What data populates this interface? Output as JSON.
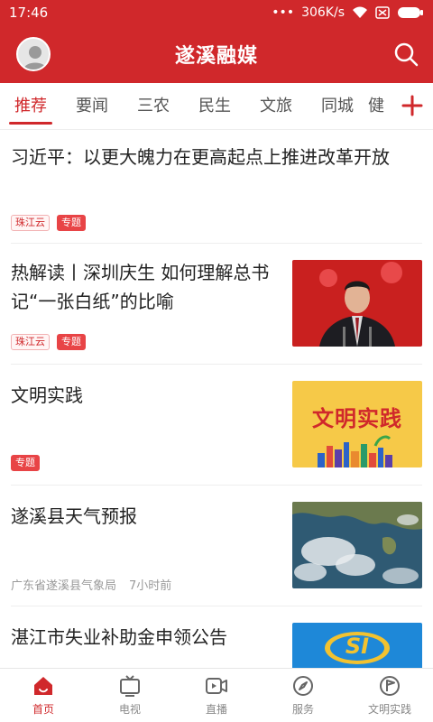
{
  "status_bar": {
    "time": "17:46",
    "network_speed": "306K/s"
  },
  "header": {
    "title": "遂溪融媒"
  },
  "tabs": [
    {
      "label": "推荐",
      "active": true
    },
    {
      "label": "要闻"
    },
    {
      "label": "三农"
    },
    {
      "label": "民生"
    },
    {
      "label": "文旅"
    },
    {
      "label": "同城"
    },
    {
      "label": "健"
    }
  ],
  "feed": [
    {
      "headline": "习近平：以更大魄力在更高起点上推进改革开放",
      "tags": [
        "珠江云",
        "专题"
      ]
    },
    {
      "headline": "热解读丨深圳庆生 如何理解总书记“一张白纸”的比喻",
      "tags": [
        "珠江云",
        "专题"
      ],
      "thumb": "portrait"
    },
    {
      "headline": "文明实践",
      "tags": [
        "专题"
      ],
      "thumb": "banner",
      "thumb_text": "文明实践"
    },
    {
      "headline": "遂溪县天气预报",
      "meta_source": "广东省遂溪县气象局",
      "meta_time": "7小时前",
      "thumb": "satellite"
    },
    {
      "headline": "湛江市失业补助金申领公告",
      "thumb": "logo",
      "thumb_text": "SI"
    }
  ],
  "bottom_nav": [
    {
      "label": "首页",
      "icon": "home-icon",
      "active": true
    },
    {
      "label": "电视",
      "icon": "tv-icon"
    },
    {
      "label": "直播",
      "icon": "video-icon"
    },
    {
      "label": "服务",
      "icon": "compass-icon"
    },
    {
      "label": "文明实践",
      "icon": "flag-icon"
    }
  ],
  "colors": {
    "brand": "#d0282b",
    "tag_border": "#f2b1b2",
    "meta": "#9a9a9a"
  }
}
